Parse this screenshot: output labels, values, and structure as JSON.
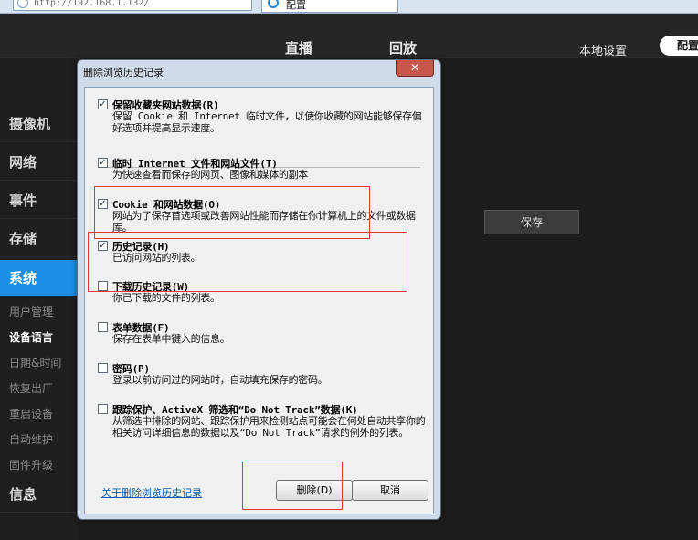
{
  "browser": {
    "address_text": "http://192.168.1.132/",
    "tab_title": "配置"
  },
  "app": {
    "nav": {
      "live": "直播",
      "playback": "回放",
      "local_settings": "本地设置"
    },
    "user_label": "配置"
  },
  "sidebar": {
    "categories": [
      "摄像机",
      "网络",
      "事件",
      "存储",
      "系统",
      "信息"
    ],
    "active_category": "系统",
    "system_subitems": [
      "用户管理",
      "设备语言",
      "日期&时间",
      "恢复出厂",
      "重启设备",
      "自动维护",
      "固件升级"
    ],
    "active_subitem": "设备语言"
  },
  "main": {
    "save_button": "保存"
  },
  "dialog": {
    "title": "删除浏览历史记录",
    "close_glyph": "✕",
    "items": [
      {
        "label": "保留收藏夹网站数据(R)",
        "description": "保留 Cookie 和 Internet 临时文件，以使你收藏的网站能够保存偏好选项并提高显示速度。",
        "checked": true
      },
      {
        "label": "临时 Internet 文件和网站文件(T)",
        "description": "为快速查看而保存的网页、图像和媒体的副本",
        "checked": true
      },
      {
        "label": "Cookie 和网站数据(O)",
        "description": "网站为了保存首选项或改善网站性能而存储在你计算机上的文件或数据库。",
        "checked": true
      },
      {
        "label": "历史记录(H)",
        "description": "已访问网站的列表。",
        "checked": true
      },
      {
        "label": "下载历史记录(W)",
        "description": "你已下载的文件的列表。",
        "checked": false
      },
      {
        "label": "表单数据(F)",
        "description": "保存在表单中键入的信息。",
        "checked": false
      },
      {
        "label": "密码(P)",
        "description": "登录以前访问过的网站时，自动填充保存的密码。",
        "checked": false
      },
      {
        "label": "跟踪保护、ActiveX 筛选和“Do Not Track”数据(K)",
        "description": "从筛选中排除的网站、跟踪保护用来检测站点可能会在何处自动共享你的相关访问详细信息的数据以及“Do Not Track”请求的例外的列表。",
        "checked": false
      }
    ],
    "check_glyph": "✓",
    "about_link": "关于删除浏览历史记录",
    "delete_button": "删除(D)",
    "cancel_button": "取消"
  },
  "colors": {
    "accent": "#1d8ee6",
    "highlight": "#e43434",
    "link": "#0b57a8"
  }
}
